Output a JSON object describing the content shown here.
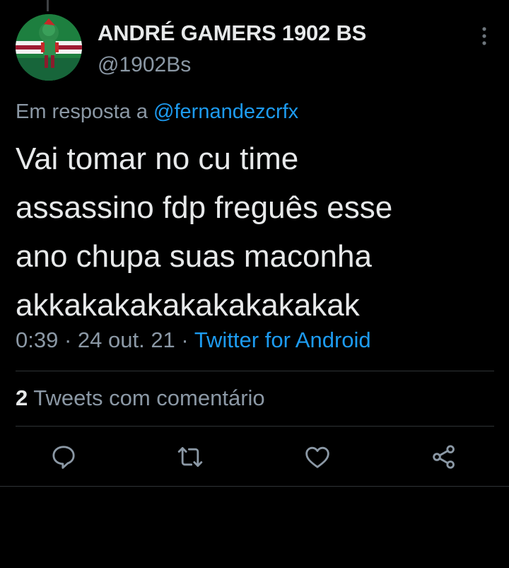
{
  "tweet": {
    "display_name": "ANDRÉ GAMERS 1902 BS",
    "handle": "@1902Bs",
    "reply_prefix": "Em resposta a ",
    "reply_mention": "@fernandezcrfx",
    "text_lines": [
      "Vai tomar no cu time",
      "assassino fdp freguês esse",
      "ano chupa suas maconha",
      "akkakakakakakakakakak"
    ],
    "time": "0:39",
    "date": "24 out. 21",
    "separator": " · ",
    "source": "Twitter for Android",
    "quote_count": "2",
    "quote_label": " Tweets com comentário"
  },
  "actions": [
    {
      "icon": "reply-icon"
    },
    {
      "icon": "retweet-icon"
    },
    {
      "icon": "like-icon"
    },
    {
      "icon": "share-icon"
    }
  ],
  "colors": {
    "background": "#000000",
    "primary_text": "#e7e9ea",
    "secondary_text": "#8b98a5",
    "link": "#1d9bf0",
    "divider": "#2f3336"
  }
}
